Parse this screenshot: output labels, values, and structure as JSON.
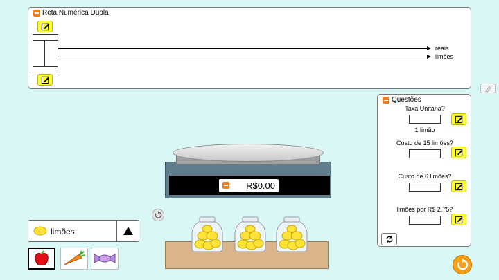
{
  "double_number_line": {
    "title": "Reta Numérica Dupla",
    "top_axis_label": "reais",
    "bottom_axis_label": "limões"
  },
  "questions": {
    "title": "Questões",
    "unit_rate_question": "Taxa Unitária?",
    "unit_rate_unit": "1 limão",
    "q2": "Custo de 15 limões?",
    "q3": "Custo de 6 limões?",
    "q4": "limões por R$ 2.75?"
  },
  "scale": {
    "display_value": "R$0.00"
  },
  "item_selector": {
    "selected_label": "limões"
  },
  "items": [
    "apple-icon",
    "carrot-icon",
    "candy-icon"
  ],
  "colors": {
    "background": "#d9f7f5",
    "edit_button": "#ffff33",
    "collapse_button": "#f07c1e",
    "lemon": "#ffe33a",
    "scale_body": "#5f7d8c",
    "shelf": "#dbb58a"
  }
}
